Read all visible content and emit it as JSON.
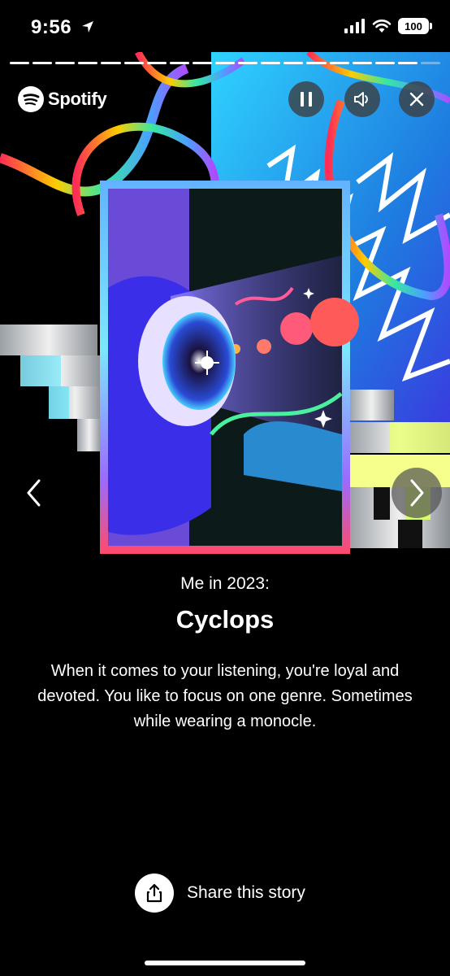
{
  "status": {
    "time": "9:56",
    "battery": "100",
    "icons": [
      "location-arrow-icon",
      "signal-icon",
      "wifi-icon",
      "battery-icon"
    ]
  },
  "story": {
    "progress_total": 19,
    "progress_completed": 18
  },
  "header": {
    "brand": "Spotify",
    "controls": [
      "pause-icon",
      "volume-icon",
      "close-icon"
    ]
  },
  "caption": {
    "subtitle": "Me in 2023:",
    "title": "Cyclops",
    "description": "When it comes to your listening, you're loyal and devoted. You like to focus on one genre. Sometimes while wearing a monocle."
  },
  "share": {
    "label": "Share this story",
    "icon": "share-icon"
  },
  "colors": {
    "background": "#000000",
    "card_border_top": "#6aa7ff",
    "card_border_bottom": "#ff4a6b",
    "right_panel": "#38b6e8"
  }
}
